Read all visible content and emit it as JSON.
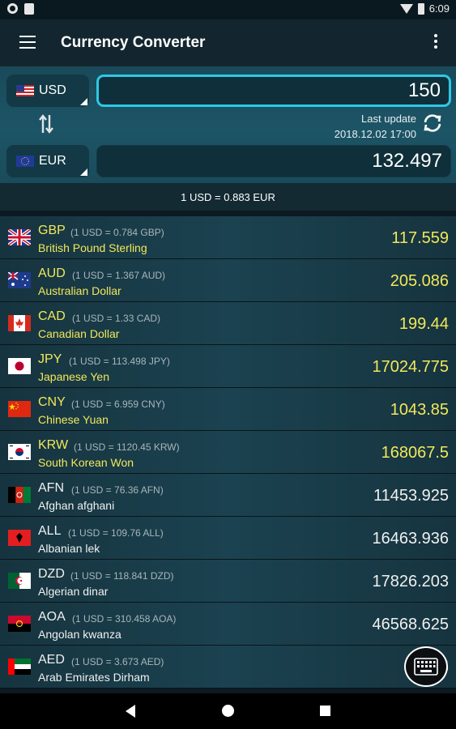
{
  "status_bar": {
    "time": "6:09"
  },
  "app_bar": {
    "title": "Currency Converter"
  },
  "converter": {
    "from": {
      "code": "USD",
      "amount": "150"
    },
    "to": {
      "code": "EUR",
      "amount": "132.497"
    },
    "last_update_label": "Last update",
    "last_update_time": "2018.12.02 17:00"
  },
  "rate_line": "1 USD = 0.883 EUR",
  "currencies": [
    {
      "code": "GBP",
      "rate": "(1 USD = 0.784 GBP)",
      "name": "British Pound Sterling",
      "value": "117.559",
      "color": "#f2e85a"
    },
    {
      "code": "AUD",
      "rate": "(1 USD = 1.367 AUD)",
      "name": "Australian Dollar",
      "value": "205.086",
      "color": "#f2e85a"
    },
    {
      "code": "CAD",
      "rate": "(1 USD = 1.33 CAD)",
      "name": "Canadian Dollar",
      "value": "199.44",
      "color": "#f2e85a"
    },
    {
      "code": "JPY",
      "rate": "(1 USD = 113.498 JPY)",
      "name": "Japanese Yen",
      "value": "17024.775",
      "color": "#f2e85a"
    },
    {
      "code": "CNY",
      "rate": "(1 USD = 6.959 CNY)",
      "name": "Chinese Yuan",
      "value": "1043.85",
      "color": "#f2e85a"
    },
    {
      "code": "KRW",
      "rate": "(1 USD = 1120.45 KRW)",
      "name": "South Korean Won",
      "value": "168067.5",
      "color": "#f2e85a"
    },
    {
      "code": "AFN",
      "rate": "(1 USD = 76.36 AFN)",
      "name": "Afghan afghani",
      "value": "11453.925",
      "color": "#f0f0f0"
    },
    {
      "code": "ALL",
      "rate": "(1 USD = 109.76 ALL)",
      "name": "Albanian lek",
      "value": "16463.936",
      "color": "#f0f0f0"
    },
    {
      "code": "DZD",
      "rate": "(1 USD = 118.841 DZD)",
      "name": "Algerian dinar",
      "value": "17826.203",
      "color": "#f0f0f0"
    },
    {
      "code": "AOA",
      "rate": "(1 USD = 310.458 AOA)",
      "name": "Angolan kwanza",
      "value": "46568.625",
      "color": "#f0f0f0"
    },
    {
      "code": "AED",
      "rate": "(1 USD = 3.673 AED)",
      "name": "Arab Emirates Dirham",
      "value": "55",
      "color": "#f0f0f0"
    }
  ],
  "icons": {
    "menu": "menu-icon",
    "more": "more-vert-icon",
    "swap": "swap-icon",
    "refresh": "refresh-icon",
    "keyboard": "keyboard-icon"
  }
}
